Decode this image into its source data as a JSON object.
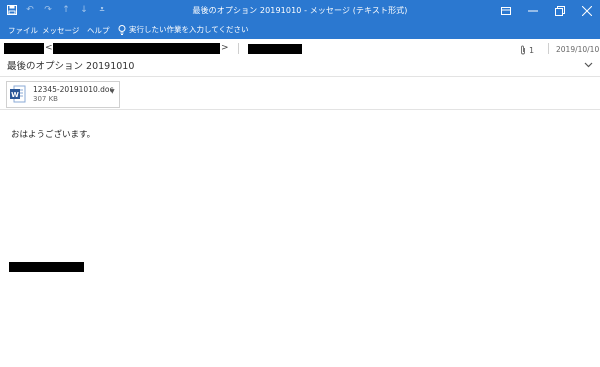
{
  "titlebar": {
    "title": "最後のオプション 20191010 - メッセージ (テキスト形式)",
    "qat": {
      "save_icon": "save-icon",
      "undo_icon": "undo-icon",
      "redo_icon": "redo-icon"
    }
  },
  "ribbon": {
    "tabs": [
      "ファイル",
      "メッセージ",
      "ヘルプ"
    ],
    "tellme": "実行したい作業を入力してください"
  },
  "message": {
    "bracket_open": "<",
    "bracket_close": ">",
    "subject": "最後のオプション 20191010",
    "attachment_count": "1",
    "date": "2019/10/10",
    "attachment": {
      "filename": "12345-20191010.doc",
      "size": "307 KB"
    },
    "body": "おはようございます。"
  },
  "colors": {
    "accent": "#2b78d0"
  }
}
